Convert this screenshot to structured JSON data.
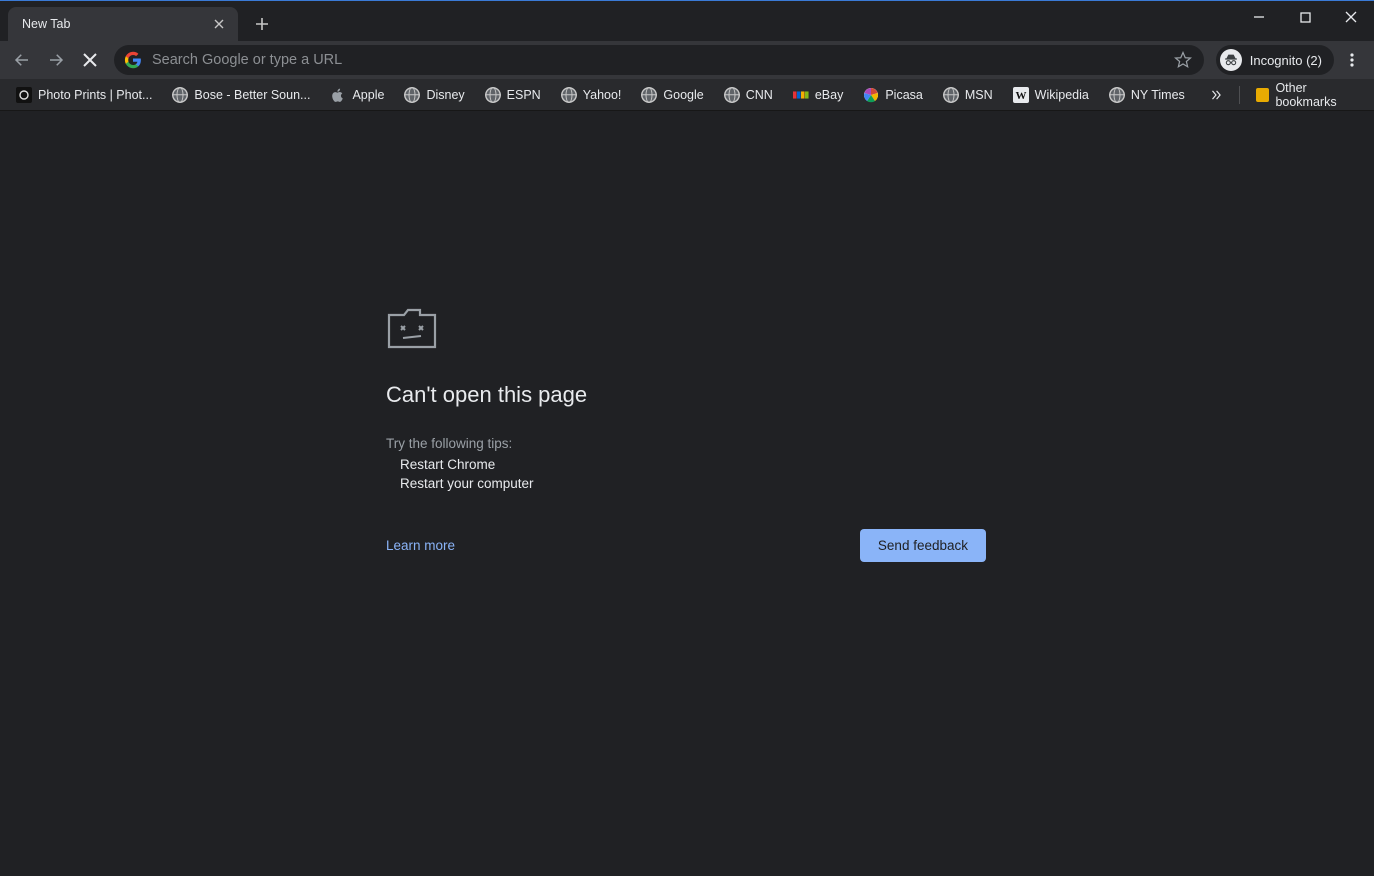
{
  "window": {
    "tab_title": "New Tab"
  },
  "toolbar": {
    "omnibox_placeholder": "Search Google or type a URL",
    "incognito_label": "Incognito (2)"
  },
  "bookmarks": {
    "items": [
      {
        "label": "Photo Prints | Phot...",
        "icon": "photo"
      },
      {
        "label": "Bose - Better Soun...",
        "icon": "globe"
      },
      {
        "label": "Apple",
        "icon": "apple"
      },
      {
        "label": "Disney",
        "icon": "globe"
      },
      {
        "label": "ESPN",
        "icon": "globe"
      },
      {
        "label": "Yahoo!",
        "icon": "globe"
      },
      {
        "label": "Google",
        "icon": "globe"
      },
      {
        "label": "CNN",
        "icon": "globe"
      },
      {
        "label": "eBay",
        "icon": "ebay"
      },
      {
        "label": "Picasa",
        "icon": "picasa"
      },
      {
        "label": "MSN",
        "icon": "globe"
      },
      {
        "label": "Wikipedia",
        "icon": "wiki"
      },
      {
        "label": "NY Times",
        "icon": "globe"
      }
    ],
    "other_label": "Other bookmarks"
  },
  "error": {
    "heading": "Can't open this page",
    "subheading": "Try the following tips:",
    "tips": [
      "Restart Chrome",
      "Restart your computer"
    ],
    "learn_more": "Learn more",
    "feedback_button": "Send feedback"
  }
}
